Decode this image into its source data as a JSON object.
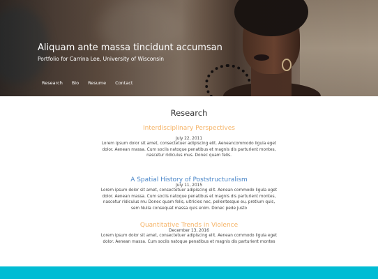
{
  "header": {
    "title": "Aliquam ante massa tincidunt accumsan",
    "subtitle": "Portfolio for Carrina Lee, University of Wisconsin"
  },
  "nav": {
    "items": [
      {
        "label": "Research"
      },
      {
        "label": "Bio"
      },
      {
        "label": "Resume"
      },
      {
        "label": "Contact"
      }
    ]
  },
  "main": {
    "section_title": "Research",
    "posts": [
      {
        "title": "Interdisciplinary Perspectives",
        "title_color": "#f5b366",
        "date": "July 22, 2011",
        "body": "Lorem ipsum dolor sit amet, consectetuer adipiscing elit. Aeneancommodo ligula eget dolor. Aenean massa. Cum sociis natoque penatibus et magnis dis parturient montes, nascetur ridiculus mus. Donec quam felis."
      },
      {
        "title": "A Spatial History of Poststructuralism",
        "title_color": "#4a86c8",
        "date": "July 11, 2015",
        "body": "Lorem ipsum dolor sit amet, consectetuer adipiscing elit. Aenean commodo ligula eget dolor. Aenean massa. Cum sociis natoque penatibus et magnis dis parturient montes, nascetur ridiculus mu Donec quam felis, ultricies nec, pellentesque eu, pretium quis, sem Nulla consequat massa quis enim. Donec pede justo"
      },
      {
        "title": "Quantitative Trends in Violence",
        "title_color": "#f5b366",
        "date": "December 13, 2016",
        "body": "Lorem ipsum dolor sit amet, consectetuer adipiscing elit. Aenean commodo ligula eget dolor. Aenean massa. Cum sociis natoque penatibus et magnis dis parturient montes"
      }
    ]
  },
  "footer": {
    "bar_color": "#00bcd4"
  }
}
